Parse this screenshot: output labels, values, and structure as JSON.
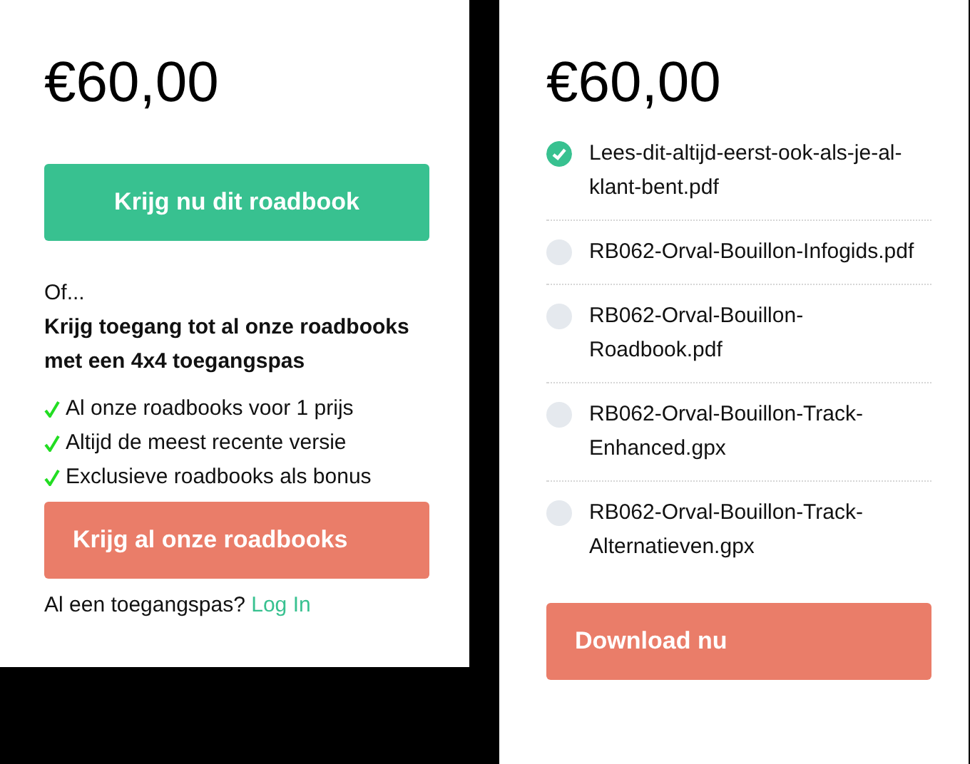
{
  "offer": {
    "price": "€60,00",
    "buy_button": "Krijg nu dit roadbook",
    "or_text": "Of...",
    "pass_heading": "Krijg toegang tot al onze roadbooks met een 4x4 toegangspas",
    "benefits": [
      "Al onze roadbooks voor 1 prijs",
      "Altijd de meest recente versie",
      "Exclusieve roadbooks als bonus"
    ],
    "pass_button": "Krijg al onze roadbooks",
    "login_prompt": "Al een toegangspas?",
    "login_link": "Log In"
  },
  "download": {
    "price": "€60,00",
    "files": [
      {
        "name": "Lees-dit-altijd-eerst-ook-als-je-al-klant-bent.pdf",
        "checked": true
      },
      {
        "name": "RB062-Orval-Bouillon-Infogids.pdf",
        "checked": false
      },
      {
        "name": "RB062-Orval-Bouillon-Roadbook.pdf",
        "checked": false
      },
      {
        "name": "RB062-Orval-Bouillon-Track-Enhanced.gpx",
        "checked": false
      },
      {
        "name": "RB062-Orval-Bouillon-Track-Alternatieven.gpx",
        "checked": false
      }
    ],
    "download_button": "Download nu"
  }
}
